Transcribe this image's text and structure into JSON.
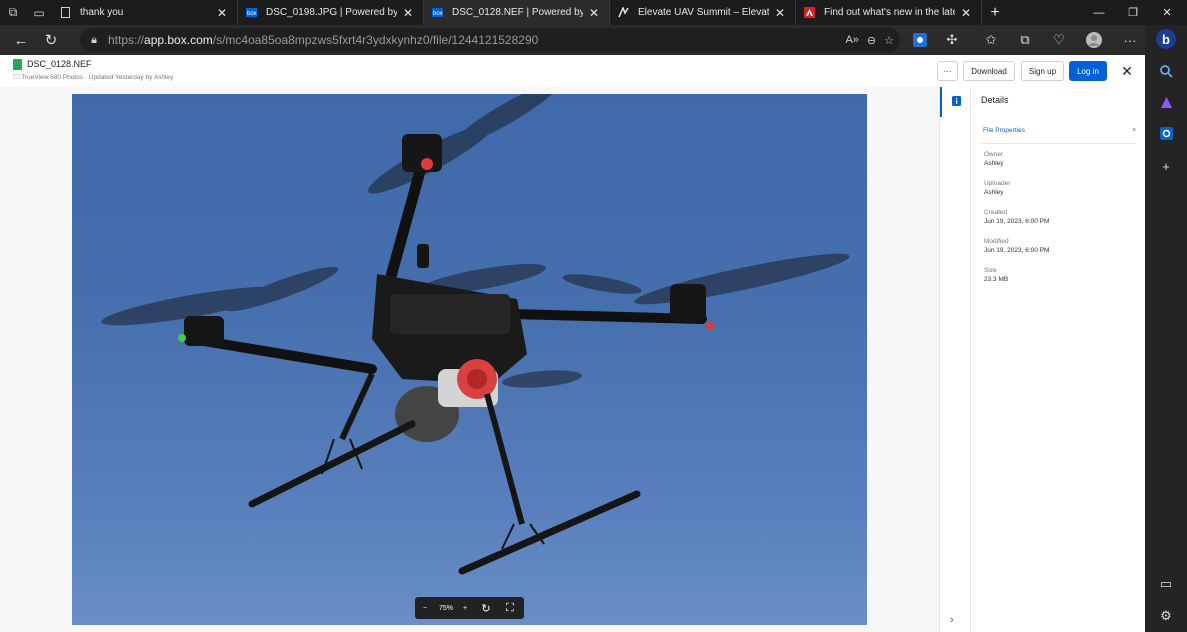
{
  "browser": {
    "tabs": [
      {
        "title": "thank you",
        "favicon": "page-icon",
        "active": false
      },
      {
        "title": "DSC_0198.JPG | Powered by Box",
        "favicon": "box-logo",
        "active": false
      },
      {
        "title": "DSC_0128.NEF | Powered by Box",
        "favicon": "box-logo",
        "active": true
      },
      {
        "title": "Elevate UAV Summit – Elevate UA",
        "favicon": "elevate-logo",
        "active": false
      },
      {
        "title": "Find out what's new in the latest",
        "favicon": "adobe-logo",
        "active": false
      }
    ],
    "url_prefix": "https://",
    "url_host": "app.box.com",
    "url_path": "/s/mc4oa85oa8mpzws5fxrt4r3ydxkynhz0/file/1244121528290"
  },
  "box": {
    "file_name": "DSC_0128.NEF",
    "file_subtitle": "TrueView 680 Photos · Updated Yesterday by Ashley",
    "buttons": {
      "more": "···",
      "download": "Download",
      "signup": "Sign up",
      "login": "Log in"
    },
    "zoom": {
      "minus": "−",
      "level": "75%",
      "plus": "+"
    }
  },
  "details": {
    "title": "Details",
    "section": "File Properties",
    "properties": [
      {
        "label": "Owner",
        "value": "Ashley"
      },
      {
        "label": "Uploader",
        "value": "Ashley"
      },
      {
        "label": "Created",
        "value": "Jun 19, 2023, 6:00 PM"
      },
      {
        "label": "Modified",
        "value": "Jun 19, 2023, 6:00 PM"
      },
      {
        "label": "Size",
        "value": "23.3 MB"
      }
    ]
  },
  "colors": {
    "accent": "#0061d5",
    "sky": "#4a72b0"
  }
}
